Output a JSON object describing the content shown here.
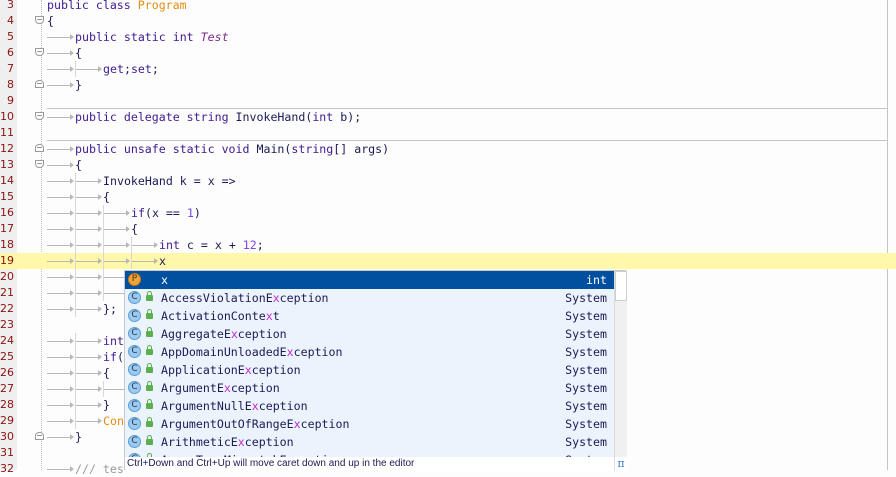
{
  "editor": {
    "current_line": 19,
    "lines": [
      {
        "n": "3",
        "indent": 0,
        "tokens": [
          [
            "kw",
            "public class "
          ],
          [
            "type",
            "Program"
          ]
        ]
      },
      {
        "n": "4",
        "indent": 0,
        "fold": "open",
        "tokens": [
          [
            "id",
            "{"
          ]
        ]
      },
      {
        "n": "5",
        "indent": 1,
        "tokens": [
          [
            "kw",
            "public static int "
          ],
          [
            "member",
            "Test"
          ]
        ]
      },
      {
        "n": "6",
        "indent": 1,
        "fold": "open",
        "tokens": [
          [
            "id",
            "{"
          ]
        ]
      },
      {
        "n": "7",
        "indent": 2,
        "tokens": [
          [
            "kw",
            "get"
          ],
          [
            "id",
            ";"
          ],
          [
            "kw",
            "set"
          ],
          [
            "id",
            ";"
          ]
        ]
      },
      {
        "n": "8",
        "indent": 1,
        "fold": "end",
        "tokens": [
          [
            "id",
            "}"
          ]
        ]
      },
      {
        "n": "9",
        "indent": 0,
        "tokens": []
      },
      {
        "n": "10",
        "indent": 1,
        "fold": "open",
        "sep": true,
        "tokens": [
          [
            "kw",
            "public delegate string "
          ],
          [
            "id",
            "InvokeHand("
          ],
          [
            "kw",
            "int"
          ],
          [
            "id",
            " b);"
          ]
        ]
      },
      {
        "n": "11",
        "indent": 0,
        "tokens": []
      },
      {
        "n": "12",
        "indent": 1,
        "fold": "end",
        "sep": true,
        "tokens": [
          [
            "kw",
            "public unsafe static void "
          ],
          [
            "id",
            "Main("
          ],
          [
            "kw",
            "string"
          ],
          [
            "id",
            "[] args)"
          ]
        ]
      },
      {
        "n": "13",
        "indent": 1,
        "fold": "open",
        "tokens": [
          [
            "id",
            "{"
          ]
        ]
      },
      {
        "n": "14",
        "indent": 2,
        "tokens": [
          [
            "id",
            "InvokeHand k = x =>"
          ]
        ]
      },
      {
        "n": "15",
        "indent": 2,
        "tokens": [
          [
            "id",
            "{"
          ]
        ]
      },
      {
        "n": "16",
        "indent": 3,
        "tokens": [
          [
            "kw",
            "if"
          ],
          [
            "id",
            "(x == "
          ],
          [
            "num",
            "1"
          ],
          [
            "id",
            ")"
          ]
        ]
      },
      {
        "n": "17",
        "indent": 3,
        "tokens": [
          [
            "id",
            "{"
          ]
        ]
      },
      {
        "n": "18",
        "indent": 4,
        "tokens": [
          [
            "kw",
            "int"
          ],
          [
            "id",
            " c = x + "
          ],
          [
            "num",
            "12"
          ],
          [
            "id",
            ";"
          ]
        ]
      },
      {
        "n": "19",
        "indent": 4,
        "tokens": [
          [
            "id",
            "x"
          ]
        ]
      },
      {
        "n": "20",
        "indent": 3,
        "tokens": []
      },
      {
        "n": "21",
        "indent": 3,
        "tokens": []
      },
      {
        "n": "22",
        "indent": 2,
        "tokens": [
          [
            "id",
            "};"
          ]
        ]
      },
      {
        "n": "23",
        "indent": 0,
        "tokens": []
      },
      {
        "n": "24",
        "indent": 2,
        "tokens": [
          [
            "kw",
            "int"
          ]
        ]
      },
      {
        "n": "25",
        "indent": 2,
        "tokens": [
          [
            "kw",
            "if"
          ],
          [
            "id",
            "("
          ]
        ]
      },
      {
        "n": "26",
        "indent": 2,
        "tokens": [
          [
            "id",
            "{"
          ]
        ]
      },
      {
        "n": "27",
        "indent": 3,
        "tokens": []
      },
      {
        "n": "28",
        "indent": 2,
        "tokens": [
          [
            "id",
            "}"
          ]
        ]
      },
      {
        "n": "29",
        "indent": 2,
        "tokens": [
          [
            "type",
            "Con"
          ]
        ]
      },
      {
        "n": "30",
        "indent": 1,
        "fold": "end",
        "tokens": [
          [
            "id",
            "}"
          ]
        ]
      },
      {
        "n": "31",
        "indent": 0,
        "tokens": []
      },
      {
        "n": "32",
        "indent": 1,
        "tokens": [
          [
            "com",
            "/// tes"
          ]
        ]
      }
    ]
  },
  "completion": {
    "items": [
      {
        "icon": "P",
        "name": [
          "",
          "x",
          ""
        ],
        "ns": "int",
        "selected": true,
        "lock": false
      },
      {
        "icon": "C",
        "name": [
          "AccessViolationE",
          "x",
          "ception"
        ],
        "ns": "System",
        "lock": true
      },
      {
        "icon": "C",
        "name": [
          "ActivationConte",
          "x",
          "t"
        ],
        "ns": "System",
        "lock": true
      },
      {
        "icon": "C",
        "name": [
          "AggregateE",
          "x",
          "ception"
        ],
        "ns": "System",
        "lock": true
      },
      {
        "icon": "C",
        "name": [
          "AppDomainUnloadedE",
          "x",
          "ception"
        ],
        "ns": "System",
        "lock": true
      },
      {
        "icon": "C",
        "name": [
          "ApplicationE",
          "x",
          "ception"
        ],
        "ns": "System",
        "lock": true
      },
      {
        "icon": "C",
        "name": [
          "ArgumentE",
          "x",
          "ception"
        ],
        "ns": "System",
        "lock": true
      },
      {
        "icon": "C",
        "name": [
          "ArgumentNullE",
          "x",
          "ception"
        ],
        "ns": "System",
        "lock": true
      },
      {
        "icon": "C",
        "name": [
          "ArgumentOutOfRangeE",
          "x",
          "ception"
        ],
        "ns": "System",
        "lock": true
      },
      {
        "icon": "C",
        "name": [
          "ArithmeticE",
          "x",
          "ception"
        ],
        "ns": "System",
        "lock": true
      },
      {
        "icon": "C",
        "name": [
          "ArrayTypeMismatchE",
          "x",
          "ception"
        ],
        "ns": "System",
        "lock": true
      }
    ],
    "footer_hint": "Ctrl+Down and Ctrl+Up will move caret down and up in the editor",
    "pi_symbol": "π"
  }
}
